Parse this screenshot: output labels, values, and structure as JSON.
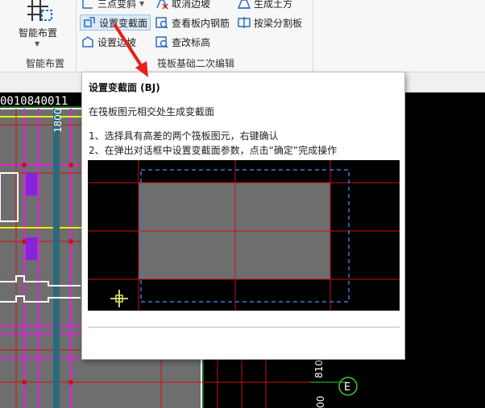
{
  "ribbon": {
    "smart_layout": {
      "label": "智能布置",
      "group_title": "智能布置"
    },
    "raft_group": {
      "title": "筏板基础二次编辑",
      "buttons": [
        {
          "id": "three-point-slope",
          "label": "三点变斜"
        },
        {
          "id": "set-varied-section",
          "label": "设置变截面"
        },
        {
          "id": "set-edge-slope",
          "label": "设置边坡"
        },
        {
          "id": "cancel-edge-slope",
          "label": "取消边坡"
        },
        {
          "id": "view-slab-rebar",
          "label": "查看板内钢筋"
        },
        {
          "id": "check-elevation",
          "label": "查改标高"
        }
      ]
    },
    "right_group": {
      "buttons": [
        {
          "id": "generate-earthwork",
          "label": "生成土方"
        },
        {
          "id": "split-by-beam",
          "label": "按梁分割板"
        }
      ]
    }
  },
  "tooltip": {
    "title": "设置变截面 (BJ)",
    "description": "在筏板图元相交处生成变截面",
    "step1": "1、选择具有高差的两个筏板图元，右键确认",
    "step2": "2、在弹出对话框中设置变截面参数，点击“确定”完成操作"
  },
  "canvas_labels": {
    "top_dims": "0010840011",
    "vertical_dim": "1800",
    "axis_label": "E",
    "bottom_dim": "810",
    "bottom_dim2": "00"
  },
  "colors": {
    "accent_blue": "#2a6ebd",
    "arrow_red": "#e8201a",
    "grid_red": "#cc1111",
    "magenta": "#e020e0",
    "yellow": "#f0f000",
    "slab_gray": "#6e6e6e"
  }
}
